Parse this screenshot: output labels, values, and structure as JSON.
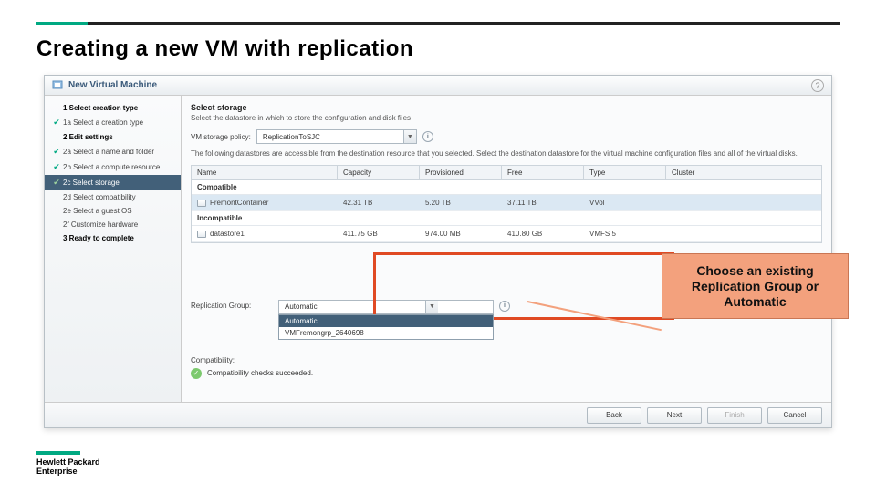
{
  "slide": {
    "title": "Creating a new VM with replication"
  },
  "wizard": {
    "title": "New Virtual Machine",
    "help": "?",
    "steps": {
      "s1": "1  Select creation type",
      "s1a": "1a Select a creation type",
      "s2": "2  Edit settings",
      "s2a": "2a Select a name and folder",
      "s2b": "2b Select a compute resource",
      "s2c": "2c Select storage",
      "s2d": "2d Select compatibility",
      "s2e": "2e Select a guest OS",
      "s2f": "2f Customize hardware",
      "s3": "3  Ready to complete"
    },
    "content": {
      "title": "Select storage",
      "subtitle": "Select the datastore in which to store the configuration and disk files",
      "policy_label": "VM storage policy:",
      "policy_value": "ReplicationToSJC",
      "desc": "The following datastores are accessible from the destination resource that you selected. Select the destination datastore for the virtual machine configuration files and all of the virtual disks.",
      "cols": {
        "c1": "Name",
        "c2": "Capacity",
        "c3": "Provisioned",
        "c4": "Free",
        "c5": "Type",
        "c6": "Cluster"
      },
      "compatible": "Compatible",
      "incompatible": "Incompatible",
      "row1": {
        "name": "FremontContainer",
        "cap": "42.31 TB",
        "prov": "5.20 TB",
        "free": "37.11 TB",
        "type": "VVol"
      },
      "row2": {
        "name": "datastore1",
        "cap": "411.75 GB",
        "prov": "974.00 MB",
        "free": "410.80 GB",
        "type": "VMFS 5"
      },
      "rg_label": "Replication Group:",
      "rg_value": "Automatic",
      "rg_opt1": "Automatic",
      "rg_opt2": "VMFremongrp_2640698",
      "compat_label": "Compatibility:",
      "compat_msg": "Compatibility checks succeeded."
    },
    "buttons": {
      "back": "Back",
      "next": "Next",
      "finish": "Finish",
      "cancel": "Cancel"
    }
  },
  "callout": "Choose an existing Replication Group or Automatic",
  "logo": {
    "l1": "Hewlett Packard",
    "l2": "Enterprise"
  }
}
